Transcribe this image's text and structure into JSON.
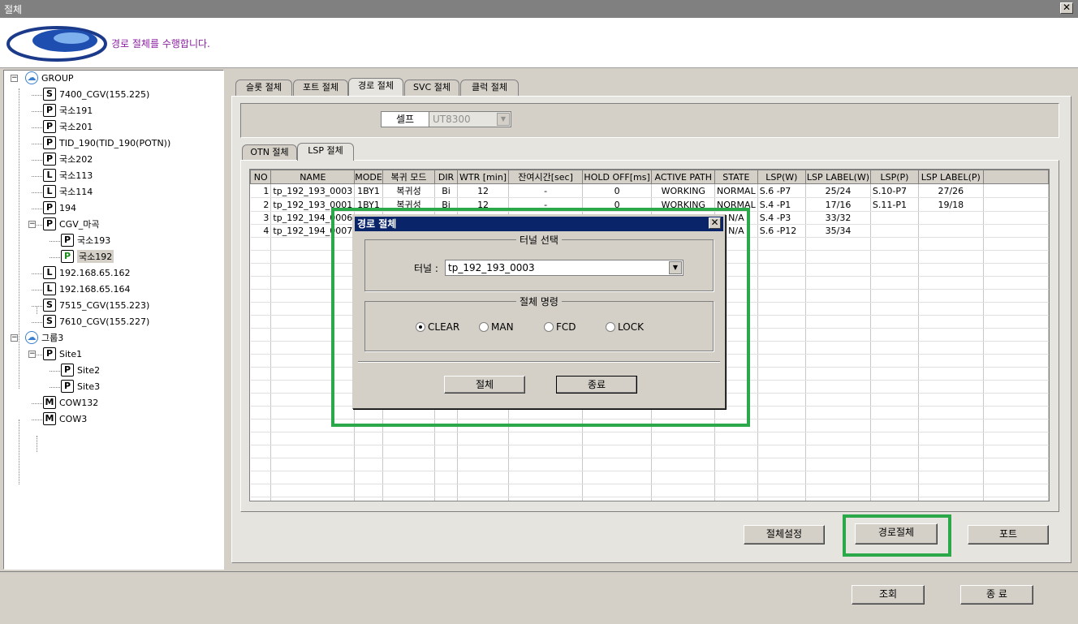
{
  "window": {
    "title": "절체"
  },
  "header": {
    "message": "경로 절체를 수행합니다."
  },
  "tree": [
    {
      "label": "GROUP",
      "icon": "cloud"
    },
    {
      "label": "7400_CGV(155.225)",
      "icon": "S"
    },
    {
      "label": "국소191",
      "icon": "P"
    },
    {
      "label": "국소201",
      "icon": "P"
    },
    {
      "label": "TID_190(TID_190(POTN))",
      "icon": "P"
    },
    {
      "label": "국소202",
      "icon": "P"
    },
    {
      "label": "국소113",
      "icon": "L"
    },
    {
      "label": "국소114",
      "icon": "L"
    },
    {
      "label": "194",
      "icon": "P"
    },
    {
      "label": "CGV_마곡",
      "icon": "P"
    },
    {
      "label": "국소193",
      "icon": "P"
    },
    {
      "label": "국소192",
      "icon": "P"
    },
    {
      "label": "192.168.65.162",
      "icon": "L"
    },
    {
      "label": "192.168.65.164",
      "icon": "L"
    },
    {
      "label": "7515_CGV(155.223)",
      "icon": "S"
    },
    {
      "label": "7610_CGV(155.227)",
      "icon": "S"
    },
    {
      "label": "그룹3",
      "icon": "cloud"
    },
    {
      "label": "Site1",
      "icon": "P"
    },
    {
      "label": "Site2",
      "icon": "P"
    },
    {
      "label": "Site3",
      "icon": "P"
    },
    {
      "label": "COW132",
      "icon": "M"
    },
    {
      "label": "COW3",
      "icon": "M"
    }
  ],
  "tabs": [
    "슬롯 절체",
    "포트 절체",
    "경로 절체",
    "SVC 절체",
    "클럭 절체"
  ],
  "shelf": {
    "label": "셀프",
    "value": "UT8300"
  },
  "subtabs": [
    "OTN 절체",
    "LSP 절체"
  ],
  "grid": {
    "columns": [
      "NO",
      "NAME",
      "MODE",
      "복귀 모드",
      "DIR",
      "WTR [min]",
      "잔여시간[sec]",
      "HOLD OFF[ms]",
      "ACTIVE PATH",
      "STATE",
      "LSP(W)",
      "LSP LABEL(W)",
      "LSP(P)",
      "LSP LABEL(P)",
      ""
    ],
    "rows": [
      [
        "1",
        "tp_192_193_0003",
        "1BY1",
        "복귀성",
        "Bi",
        "12",
        "-",
        "0",
        "WORKING",
        "NORMAL",
        "S.6 -P7",
        "25/24",
        "S.10-P7",
        "27/26",
        ""
      ],
      [
        "2",
        "tp_192_193_0001",
        "1BY1",
        "복귀성",
        "Bi",
        "12",
        "-",
        "0",
        "WORKING",
        "NORMAL",
        "S.4 -P1",
        "17/16",
        "S.11-P1",
        "19/18",
        ""
      ],
      [
        "3",
        "tp_192_194_0006",
        "",
        "",
        "",
        "",
        "",
        "",
        "",
        "N/A",
        "S.4 -P3",
        "33/32",
        "",
        "",
        ""
      ],
      [
        "4",
        "tp_192_194_0007",
        "",
        "",
        "",
        "",
        "",
        "",
        "",
        "N/A",
        "S.6 -P12",
        "35/34",
        "",
        "",
        ""
      ]
    ]
  },
  "buttons": {
    "switch_setting": "절체설정",
    "path_switch": "경로절체",
    "port": "포트",
    "query": "조회",
    "exit": "종 료"
  },
  "dialog": {
    "title": "경로 절체",
    "tunnel_group": "터널 선택",
    "tunnel_label": "터널 :",
    "tunnel_value": "tp_192_193_0003",
    "command_group": "절체 명령",
    "commands": [
      "CLEAR",
      "MAN",
      "FCD",
      "LOCK"
    ],
    "selected_command": "CLEAR",
    "ok": "절체",
    "close": "종료"
  },
  "colors": {
    "accent_highlight": "#2aa84a",
    "dialog_title": "#0a246a",
    "header_msg": "#8a1ea0"
  }
}
